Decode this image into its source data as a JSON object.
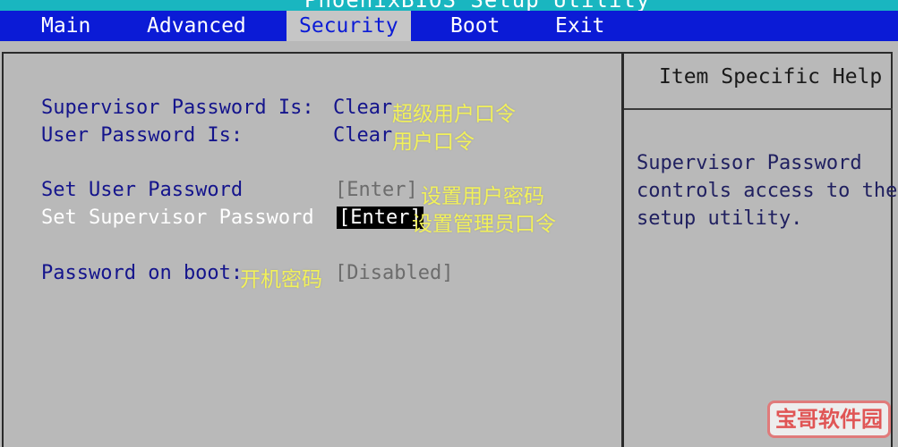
{
  "title_bar": {
    "text": "PhoenixBIOS Setup Utility"
  },
  "menu": {
    "items": [
      {
        "label": "Main",
        "active": false
      },
      {
        "label": "Advanced",
        "active": false
      },
      {
        "label": "Security",
        "active": true
      },
      {
        "label": "Boot",
        "active": false
      },
      {
        "label": "Exit",
        "active": false
      }
    ]
  },
  "settings": {
    "supervisor_status": {
      "label": "Supervisor Password Is:",
      "value": "Clear",
      "annotation": "超级用户口令"
    },
    "user_status": {
      "label": "User Password Is:",
      "value": "Clear",
      "annotation": "用户口令"
    },
    "set_user_password": {
      "label": "Set User Password",
      "value": "[Enter]",
      "annotation": "设置用户密码"
    },
    "set_supervisor_password": {
      "label": "Set Supervisor Password",
      "value": "[Enter]",
      "annotation": "设置管理员口令"
    },
    "password_on_boot": {
      "label": "Password on boot:",
      "value": "[Disabled]",
      "annotation": "开机密码"
    }
  },
  "help": {
    "title": "Item Specific Help",
    "lines": [
      "Supervisor Password",
      "controls access to the",
      "setup utility."
    ]
  },
  "watermark": {
    "text": "宝哥软件园"
  },
  "colors": {
    "menu_bar": "#0b1bd6",
    "panel_bg": "#b9b9b9",
    "label_blue": "#14148c",
    "annotation_yellow": "#f2f15a",
    "title_cyan": "#19b6c0"
  }
}
